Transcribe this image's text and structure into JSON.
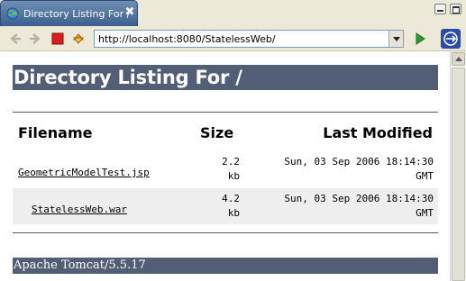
{
  "tab": {
    "title": "Directory Listing For /",
    "close_glyph": "✖"
  },
  "toolbar": {
    "url": "http://localhost:8080/StatelessWeb/",
    "icons": [
      "back-icon",
      "forward-icon",
      "stop-icon",
      "refresh-icon",
      "go-icon",
      "web-browser-icon"
    ],
    "stop_color": "#d81e1e",
    "go_color": "#2e9b32"
  },
  "page": {
    "heading": "Directory Listing For /",
    "columns": {
      "filename": "Filename",
      "size": "Size",
      "modified": "Last Modified"
    },
    "rows": [
      {
        "name": "GeometricModelTest.jsp",
        "size_value": "2.2",
        "size_unit": "kb",
        "modified_line1": "Sun, 03 Sep 2006 18:14:30",
        "modified_line2": "GMT"
      },
      {
        "name": "StatelessWeb.war",
        "size_value": "4.2",
        "size_unit": "kb",
        "modified_line1": "Sun, 03 Sep 2006 18:14:30",
        "modified_line2": "GMT"
      }
    ],
    "footer": "Apache Tomcat/5.5.17",
    "header_bar_color": "#525d76",
    "alt_row_color": "#eeeeee"
  }
}
